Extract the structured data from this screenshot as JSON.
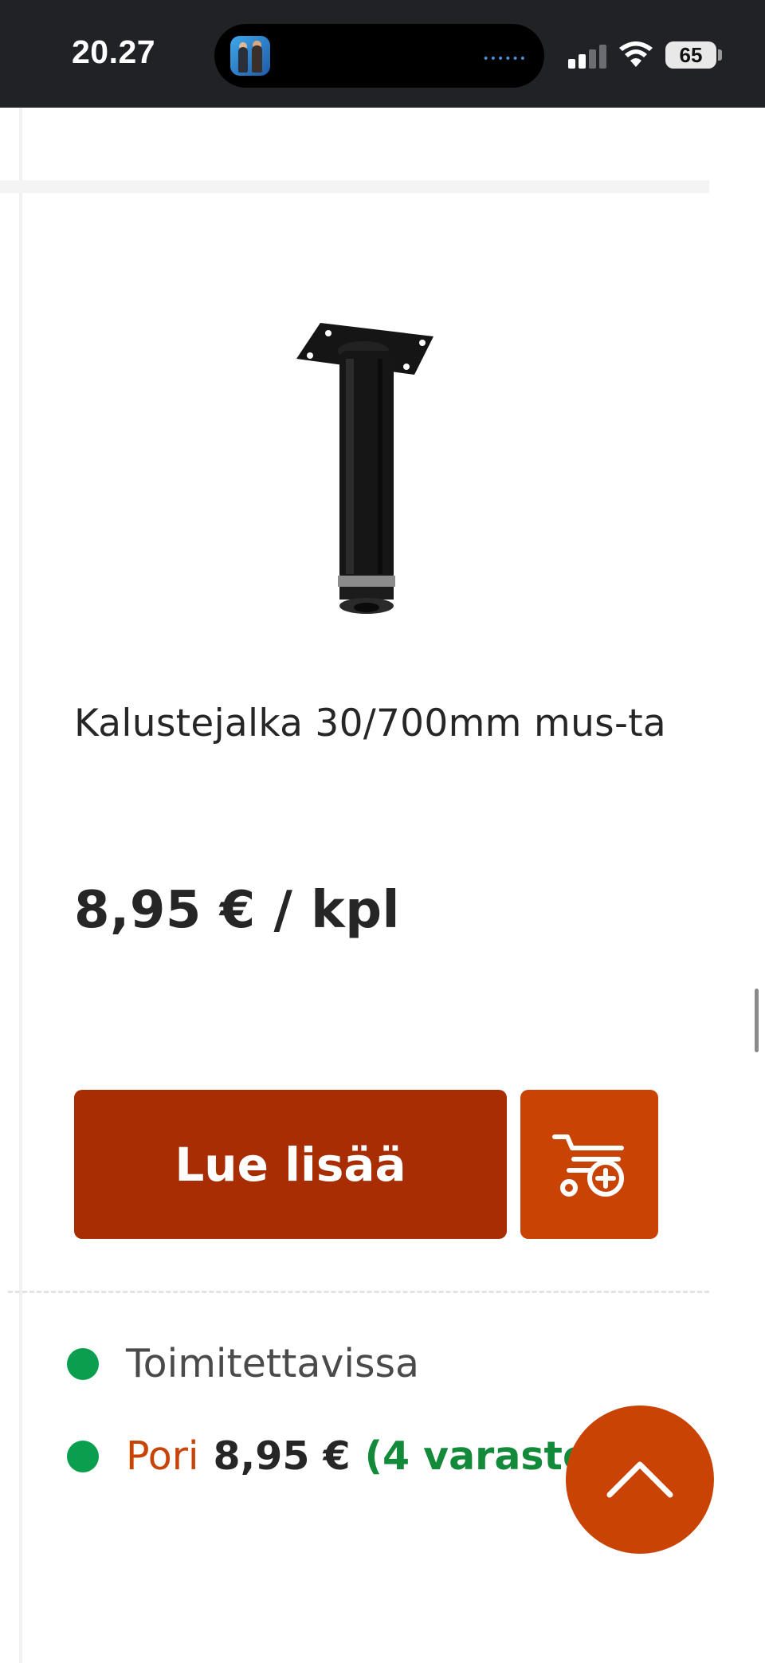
{
  "status_bar": {
    "time": "20.27",
    "battery": "65"
  },
  "product": {
    "title": "Kalustejalka 30/700mm mus-ta",
    "price": "8,95 € / kpl"
  },
  "actions": {
    "read_more_label": "Lue lisää",
    "add_to_cart_icon": "cart-plus-icon"
  },
  "availability": {
    "delivery_label": "Toimitettavissa",
    "store_name": "Pori",
    "store_price": "8,95 €",
    "store_stock": "(4 varastos"
  },
  "colors": {
    "primary_button": "#a82d03",
    "accent": "#c94305",
    "in_stock": "#0a9e4f",
    "stock_text": "#138a3a"
  }
}
